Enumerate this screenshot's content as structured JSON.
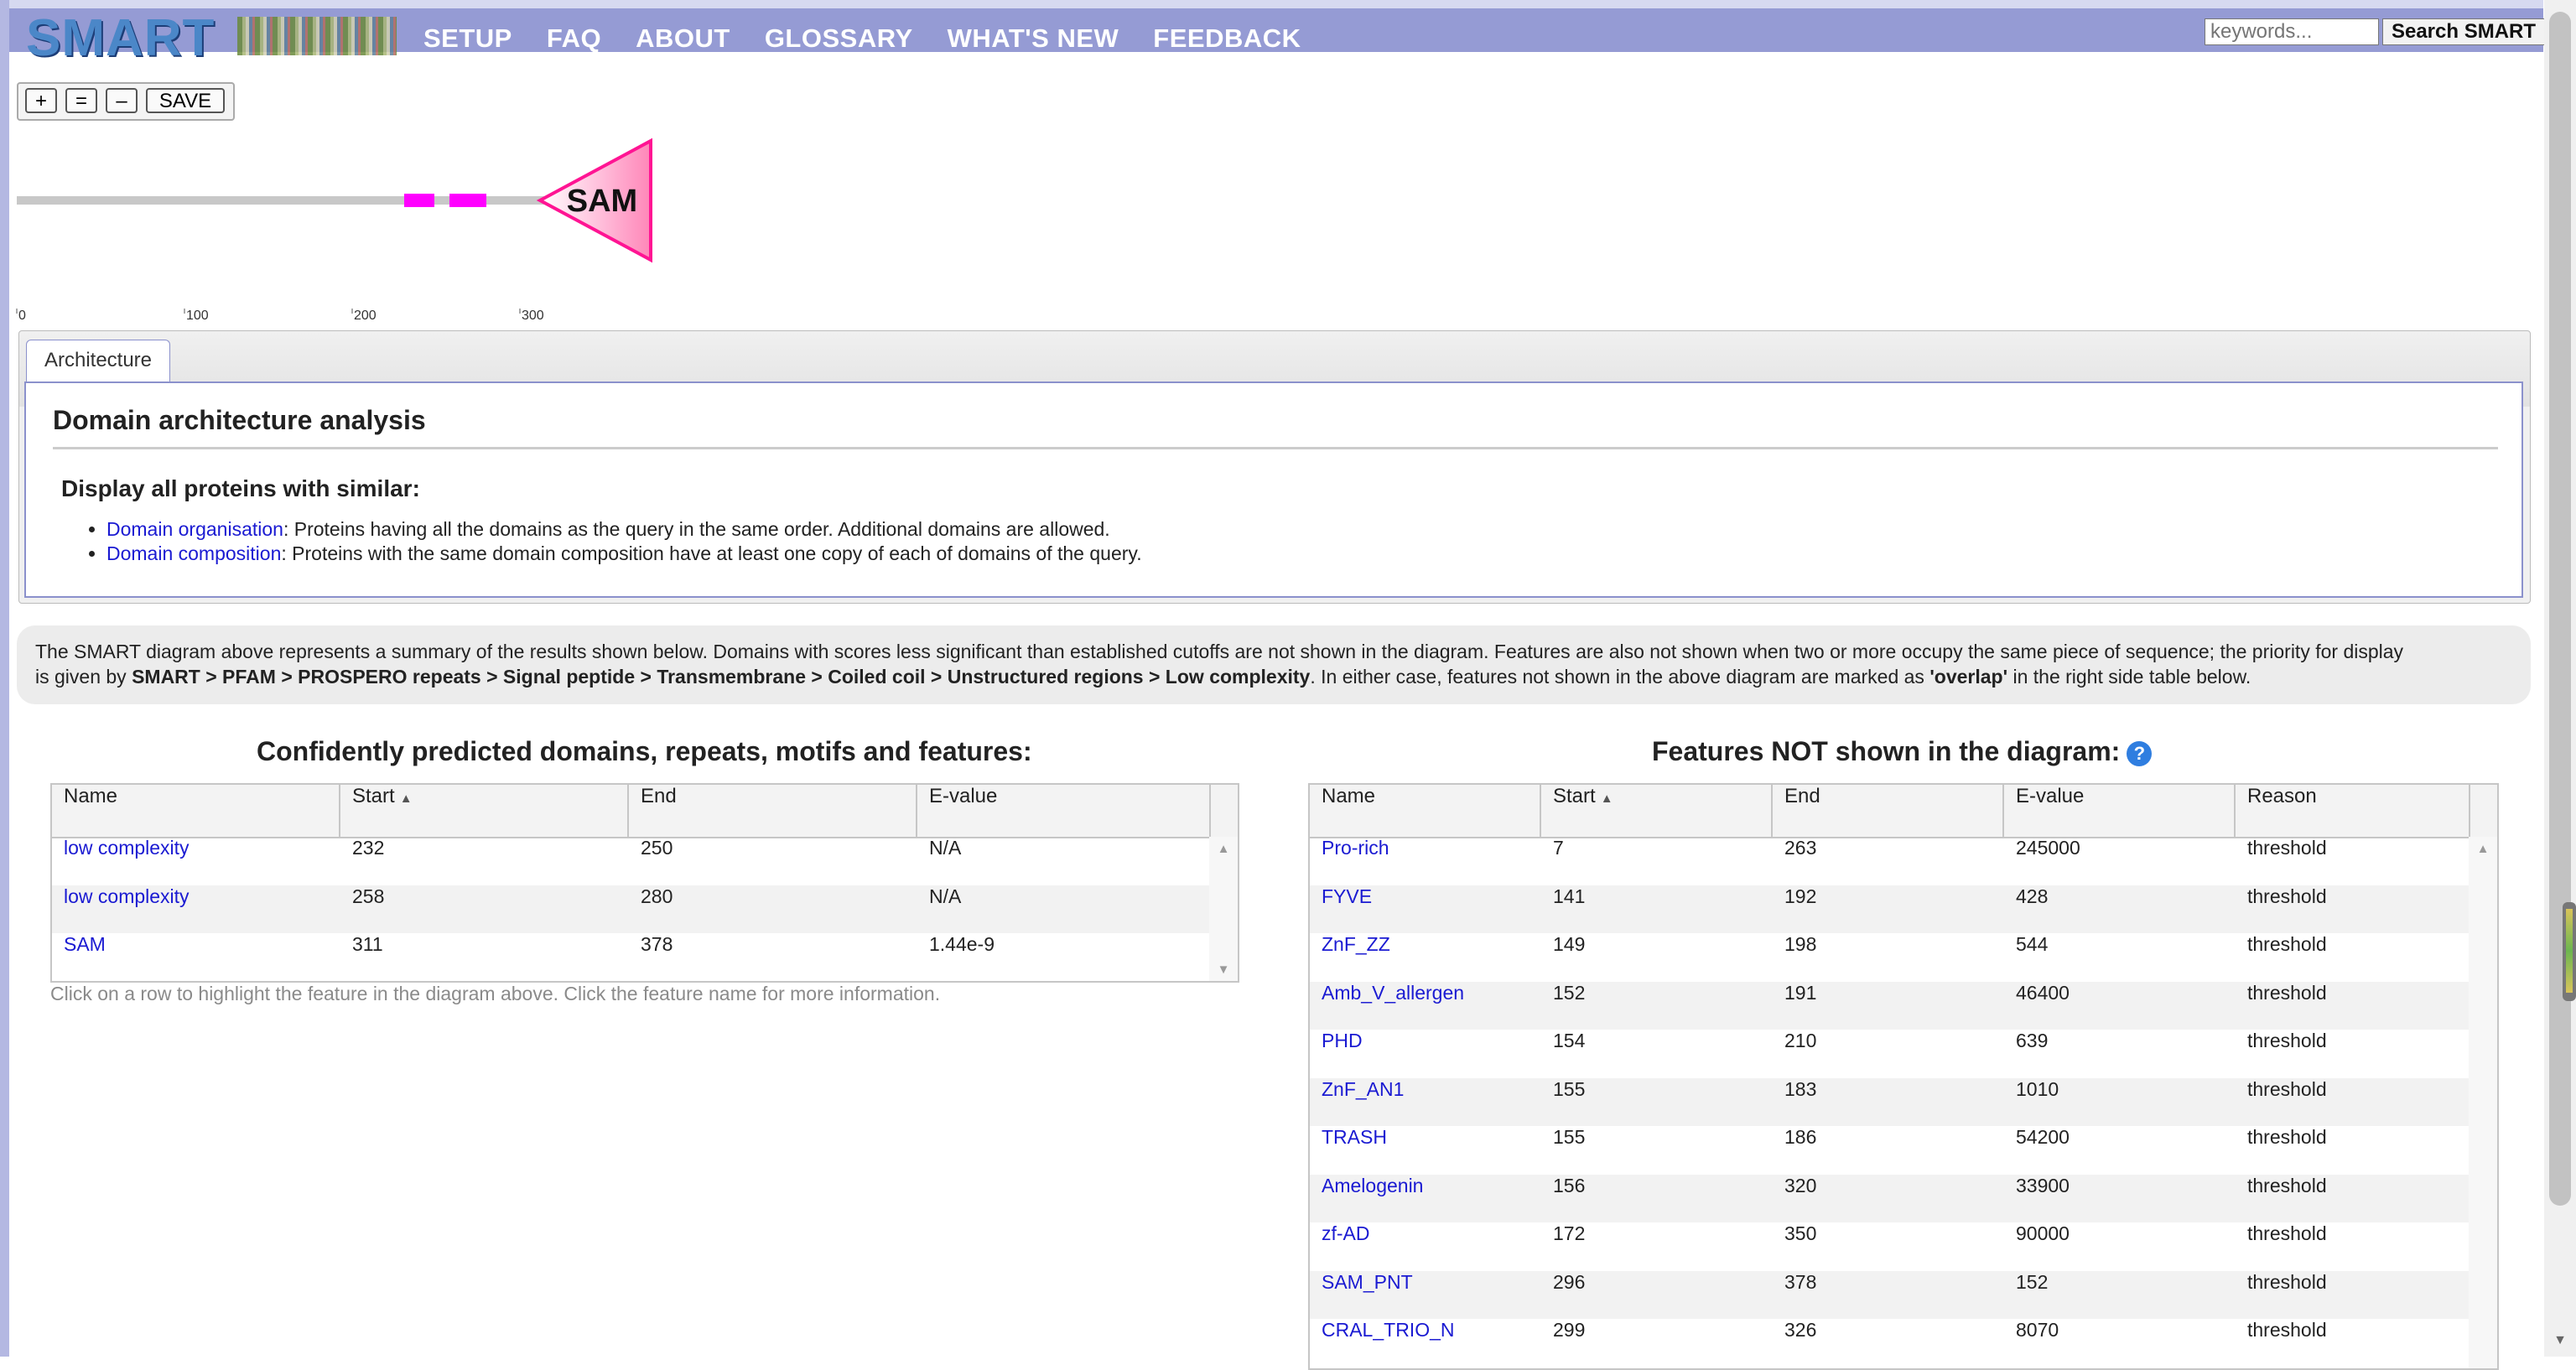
{
  "header": {
    "logo": "SMART",
    "nav": [
      "SETUP",
      "FAQ",
      "ABOUT",
      "GLOSSARY",
      "WHAT'S NEW",
      "FEEDBACK"
    ],
    "search_placeholder": "keywords...",
    "search_button": "Search SMART",
    "colors": {
      "bar": "#959bd4",
      "link": "#1a1ad2"
    }
  },
  "zoom": {
    "plus": "+",
    "equal": "=",
    "minus": "–",
    "save": "SAVE"
  },
  "diagram": {
    "domain_label": "SAM",
    "axis_ticks": [
      "0",
      "100",
      "200",
      "300"
    ],
    "colors": {
      "low_complexity": "#ff00ff",
      "sam": "#ff1493",
      "backbone": "#c8c8c8"
    }
  },
  "tabs": {
    "active": "Architecture",
    "panel": {
      "title": "Domain architecture analysis",
      "subtitle": "Display all proteins with similar:",
      "items": [
        {
          "link": "Domain organisation",
          "text": ": Proteins having all the domains as the query in the same order. Additional domains are allowed."
        },
        {
          "link": "Domain composition",
          "text": ": Proteins with the same domain composition have at least one copy of each of domains of the query."
        }
      ]
    }
  },
  "summary": {
    "line1": "The SMART diagram above represents a summary of the results shown below. Domains with scores less significant than established cutoffs are not shown in the diagram. Features are also not shown when two or more occupy the same piece of sequence; the priority for display",
    "line2_prefix": "is given by ",
    "priority": "SMART > PFAM > PROSPERO repeats > Signal peptide > Transmembrane > Coiled coil > Unstructured regions > Low complexity",
    "line2_mid": ". In either case, features not shown in the above diagram are marked as ",
    "overlap": "'overlap'",
    "line2_suffix": " in the right side table below."
  },
  "predicted": {
    "title": "Confidently predicted domains, repeats, motifs and features:",
    "columns": [
      "Name",
      "Start",
      "End",
      "E-value"
    ],
    "rows": [
      {
        "name": "low complexity",
        "start": "232",
        "end": "250",
        "evalue": "N/A"
      },
      {
        "name": "low complexity",
        "start": "258",
        "end": "280",
        "evalue": "N/A"
      },
      {
        "name": "SAM",
        "start": "311",
        "end": "378",
        "evalue": "1.44e-9"
      }
    ],
    "note": "Click on a row to highlight the feature in the diagram above. Click the feature name for more information."
  },
  "not_shown": {
    "title": "Features NOT shown in the diagram:",
    "help": "?",
    "columns": [
      "Name",
      "Start",
      "End",
      "E-value",
      "Reason"
    ],
    "rows": [
      {
        "name": "Pro-rich",
        "start": "7",
        "end": "263",
        "evalue": "245000",
        "reason": "threshold"
      },
      {
        "name": "FYVE",
        "start": "141",
        "end": "192",
        "evalue": "428",
        "reason": "threshold"
      },
      {
        "name": "ZnF_ZZ",
        "start": "149",
        "end": "198",
        "evalue": "544",
        "reason": "threshold"
      },
      {
        "name": "Amb_V_allergen",
        "start": "152",
        "end": "191",
        "evalue": "46400",
        "reason": "threshold"
      },
      {
        "name": "PHD",
        "start": "154",
        "end": "210",
        "evalue": "639",
        "reason": "threshold"
      },
      {
        "name": "ZnF_AN1",
        "start": "155",
        "end": "183",
        "evalue": "1010",
        "reason": "threshold"
      },
      {
        "name": "TRASH",
        "start": "155",
        "end": "186",
        "evalue": "54200",
        "reason": "threshold"
      },
      {
        "name": "Amelogenin",
        "start": "156",
        "end": "320",
        "evalue": "33900",
        "reason": "threshold"
      },
      {
        "name": "zf-AD",
        "start": "172",
        "end": "350",
        "evalue": "90000",
        "reason": "threshold"
      },
      {
        "name": "SAM_PNT",
        "start": "296",
        "end": "378",
        "evalue": "152",
        "reason": "threshold"
      },
      {
        "name": "CRAL_TRIO_N",
        "start": "299",
        "end": "326",
        "evalue": "8070",
        "reason": "threshold"
      }
    ]
  }
}
